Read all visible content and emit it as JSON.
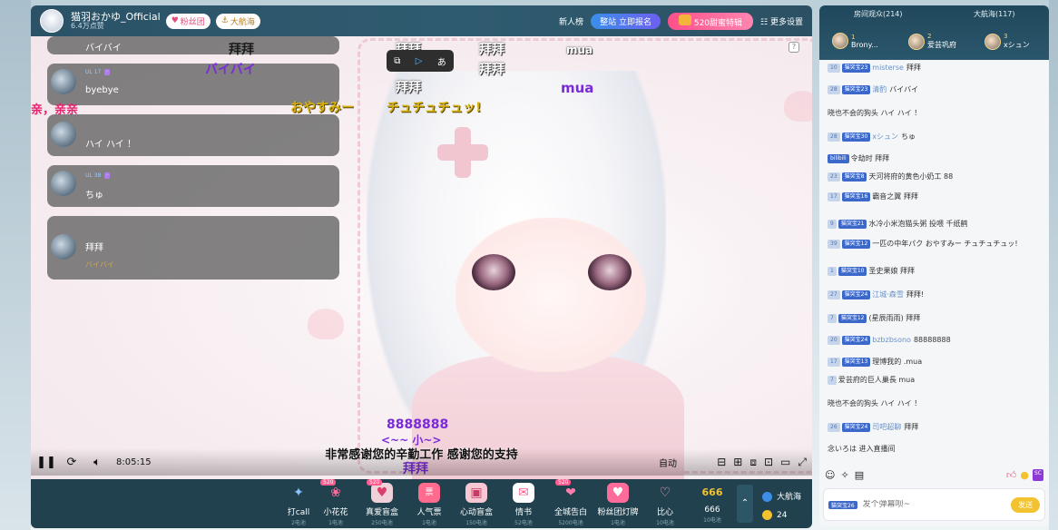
{
  "header": {
    "anchor_name": "猫羽おかゆ_Official",
    "anchor_sub": "6.4万点赞",
    "fan_pill": "粉丝团",
    "fleet_pill": "大航海",
    "new_rank": "新人榜",
    "rec_badge_prefix": "整站",
    "rec_badge": "立即报名",
    "badge_520": "520甜蜜特辑",
    "more_settings": "更多设置"
  },
  "video": {
    "help": "?",
    "subtitle": "非常感谢您的辛勤工作 感谢您的支持",
    "danmaku": [
      {
        "text": "拜拜",
        "style": "black"
      },
      {
        "text": "バイバイ",
        "style": "purple"
      },
      {
        "text": "亲，亲亲",
        "style": "red"
      },
      {
        "text": "おやすみー",
        "style": "yellow"
      },
      {
        "text": "チュチュチュッ!",
        "style": "yellow"
      },
      {
        "text": "拜拜",
        "style": "white"
      },
      {
        "text": "拜拜",
        "style": "white"
      },
      {
        "text": "拜拜",
        "style": "white"
      },
      {
        "text": "拜拜",
        "style": "white"
      },
      {
        "text": "mua",
        "style": "white"
      },
      {
        "text": "mua",
        "style": "purple"
      },
      {
        "text": "8888888",
        "style": "purple"
      },
      {
        "text": "<~~ 小~>",
        "style": "purple"
      },
      {
        "text": "拜拜",
        "style": "purple"
      }
    ],
    "bubbles": [
      {
        "top_line": "",
        "text": "バイバイ"
      },
      {
        "top_line": "UL 17",
        "text": "byebye"
      },
      {
        "top_line": "",
        "text": "ハイ ハイ ！"
      },
      {
        "top_line": "UL 38",
        "text": "ちゅ"
      },
      {
        "top_line": "",
        "text": "拜拜",
        "sub": "バイバイ"
      }
    ],
    "mini_toolbar": [
      "⧉",
      "▷",
      "あ"
    ]
  },
  "controls": {
    "time": "8:05:15",
    "auto": "自动"
  },
  "gifts": [
    {
      "name": "打call",
      "price": "2电池",
      "tag": ""
    },
    {
      "name": "小花花",
      "price": "1电池",
      "tag": "520"
    },
    {
      "name": "真爱盲盒",
      "price": "250电池",
      "tag": "520"
    },
    {
      "name": "人气票",
      "price": "1电池",
      "tag": ""
    },
    {
      "name": "心动盲盒",
      "price": "150电池",
      "tag": ""
    },
    {
      "name": "情书",
      "price": "52电池",
      "tag": ""
    },
    {
      "name": "全城告白",
      "price": "5200电池",
      "tag": "520"
    },
    {
      "name": "粉丝团灯牌",
      "price": "1电池",
      "tag": ""
    },
    {
      "name": "比心",
      "price": "10电池",
      "tag": ""
    },
    {
      "name": "666",
      "price": "10电池",
      "tag": ""
    }
  ],
  "gift_right": {
    "fleet": "大航海",
    "count": "24"
  },
  "panel": {
    "audience_tab": "房间观众(214)",
    "fleet_tab": "大航海(117)",
    "ranks": [
      {
        "num": "1",
        "name": "Brony..."
      },
      {
        "num": "2",
        "name": "爱芸巩府"
      },
      {
        "num": "3",
        "name": "xシュン"
      }
    ],
    "messages": [
      {
        "lv": "10",
        "medal": "猫突宝23",
        "name": "misterse",
        "text": "拜拜"
      },
      {
        "lv": "28",
        "medal": "猫突宝23",
        "name": "清酌",
        "text": "バイバイ"
      },
      {
        "lv": "",
        "medal": "",
        "name": "",
        "text": "晓也不会的狗头 ハイ ハイ ！"
      },
      {
        "lv": "28",
        "medal": "猫突宝30",
        "name": "xシュン",
        "text": "ちゅ"
      },
      {
        "lv": "",
        "medal": "bilibili",
        "name": "",
        "text": "令劫时 拜拜"
      },
      {
        "lv": "23",
        "medal": "猫突宝8",
        "name": "",
        "text": "天河将府的黄色小奶工 88"
      },
      {
        "lv": "17",
        "medal": "猫突宝16",
        "name": "",
        "text": "霸音之翼 拜拜"
      },
      {
        "lv": "9",
        "medal": "猫突宝21",
        "name": "",
        "text": "水冷小米泡猫头粥 投喂 千纸鹤"
      },
      {
        "lv": "39",
        "medal": "猫突宝12",
        "name": "",
        "text": "一匹の中年パク おやすみー チュチュチュッ!"
      },
      {
        "lv": "1",
        "medal": "猫突宝10",
        "name": "",
        "text": "圣史果娘 拜拜"
      },
      {
        "lv": "27",
        "medal": "猫突宝24",
        "name": "江城·森雪",
        "text": "拜拜!"
      },
      {
        "lv": "7",
        "medal": "猫突宝12",
        "name": "",
        "text": "(星辰雨雨) 拜拜"
      },
      {
        "lv": "20",
        "medal": "猫突宝24",
        "name": "bzbzbsono",
        "text": "88888888"
      },
      {
        "lv": "17",
        "medal": "猫突宝13",
        "name": "",
        "text": "理博我的 .mua"
      },
      {
        "lv": "7",
        "medal": "",
        "name": "",
        "text": "爱芸府的巨人巢長 mua"
      },
      {
        "lv": "",
        "medal": "",
        "name": "",
        "text": "晓也不会的狗头 ハイ ハイ ！"
      },
      {
        "lv": "26",
        "medal": "猫突宝24",
        "name": "司吧超聊",
        "text": "拜拜"
      },
      {
        "lv": "",
        "medal": "",
        "name": "",
        "text": "念いろは 进入直播间"
      }
    ],
    "input_medal": "猫突宝26",
    "input_placeholder": "发个弹幕呗~",
    "send": "发送",
    "sc": "SC"
  }
}
